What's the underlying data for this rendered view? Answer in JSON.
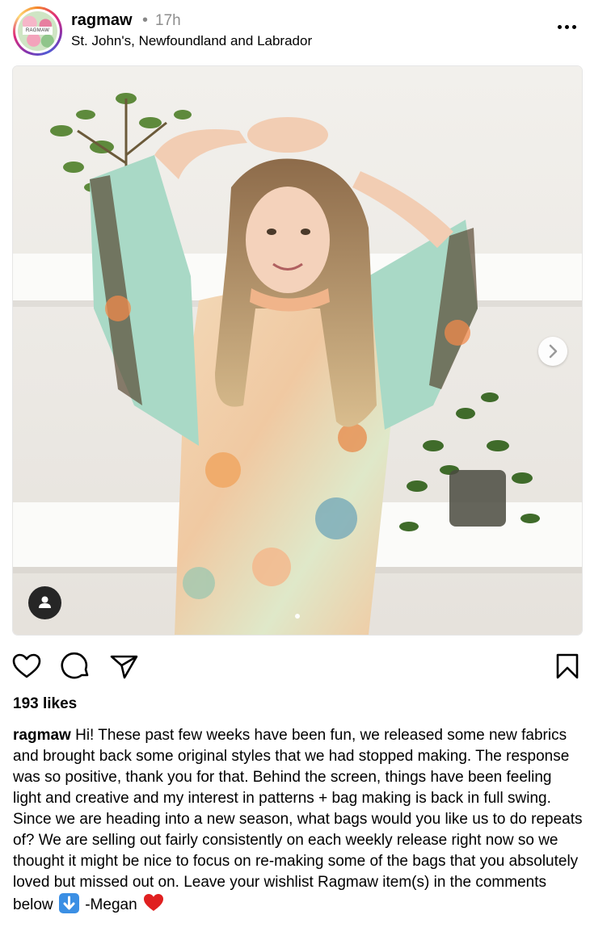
{
  "post": {
    "username": "ragmaw",
    "separator": "•",
    "time": "17h",
    "location": "St. John's, Newfoundland and Labrador",
    "avatar_text": "RAGMAW"
  },
  "icons": {
    "more": "more-horizontal-icon",
    "like": "heart-icon",
    "comment": "comment-icon",
    "share": "send-icon",
    "save": "bookmark-icon",
    "next": "chevron-right-icon",
    "tag": "user-tag-icon"
  },
  "colors": {
    "avatar_ring": "#dd2a7b",
    "text": "#000000",
    "muted": "#8e8e8e",
    "emoji_arrow": "#3b8fe4",
    "emoji_heart": "#e02020"
  },
  "likes": "193 likes",
  "caption": {
    "username": "ragmaw",
    "text": "Hi! These past few weeks have been fun, we released some new fabrics and brought back some original styles that we had stopped making. The response was so positive, thank you for that. Behind the screen, things have been feeling light and creative and my interest in patterns + bag making is back in full swing. Since we are heading into a new season, what bags would you like us to do repeats of? We are selling out fairly consistently on each weekly release right now so we thought it might be nice to focus on re-making some of the bags that you absolutely loved but missed out on. Leave your wishlist Ragmaw item(s) in the comments below",
    "signature": "-Megan"
  }
}
